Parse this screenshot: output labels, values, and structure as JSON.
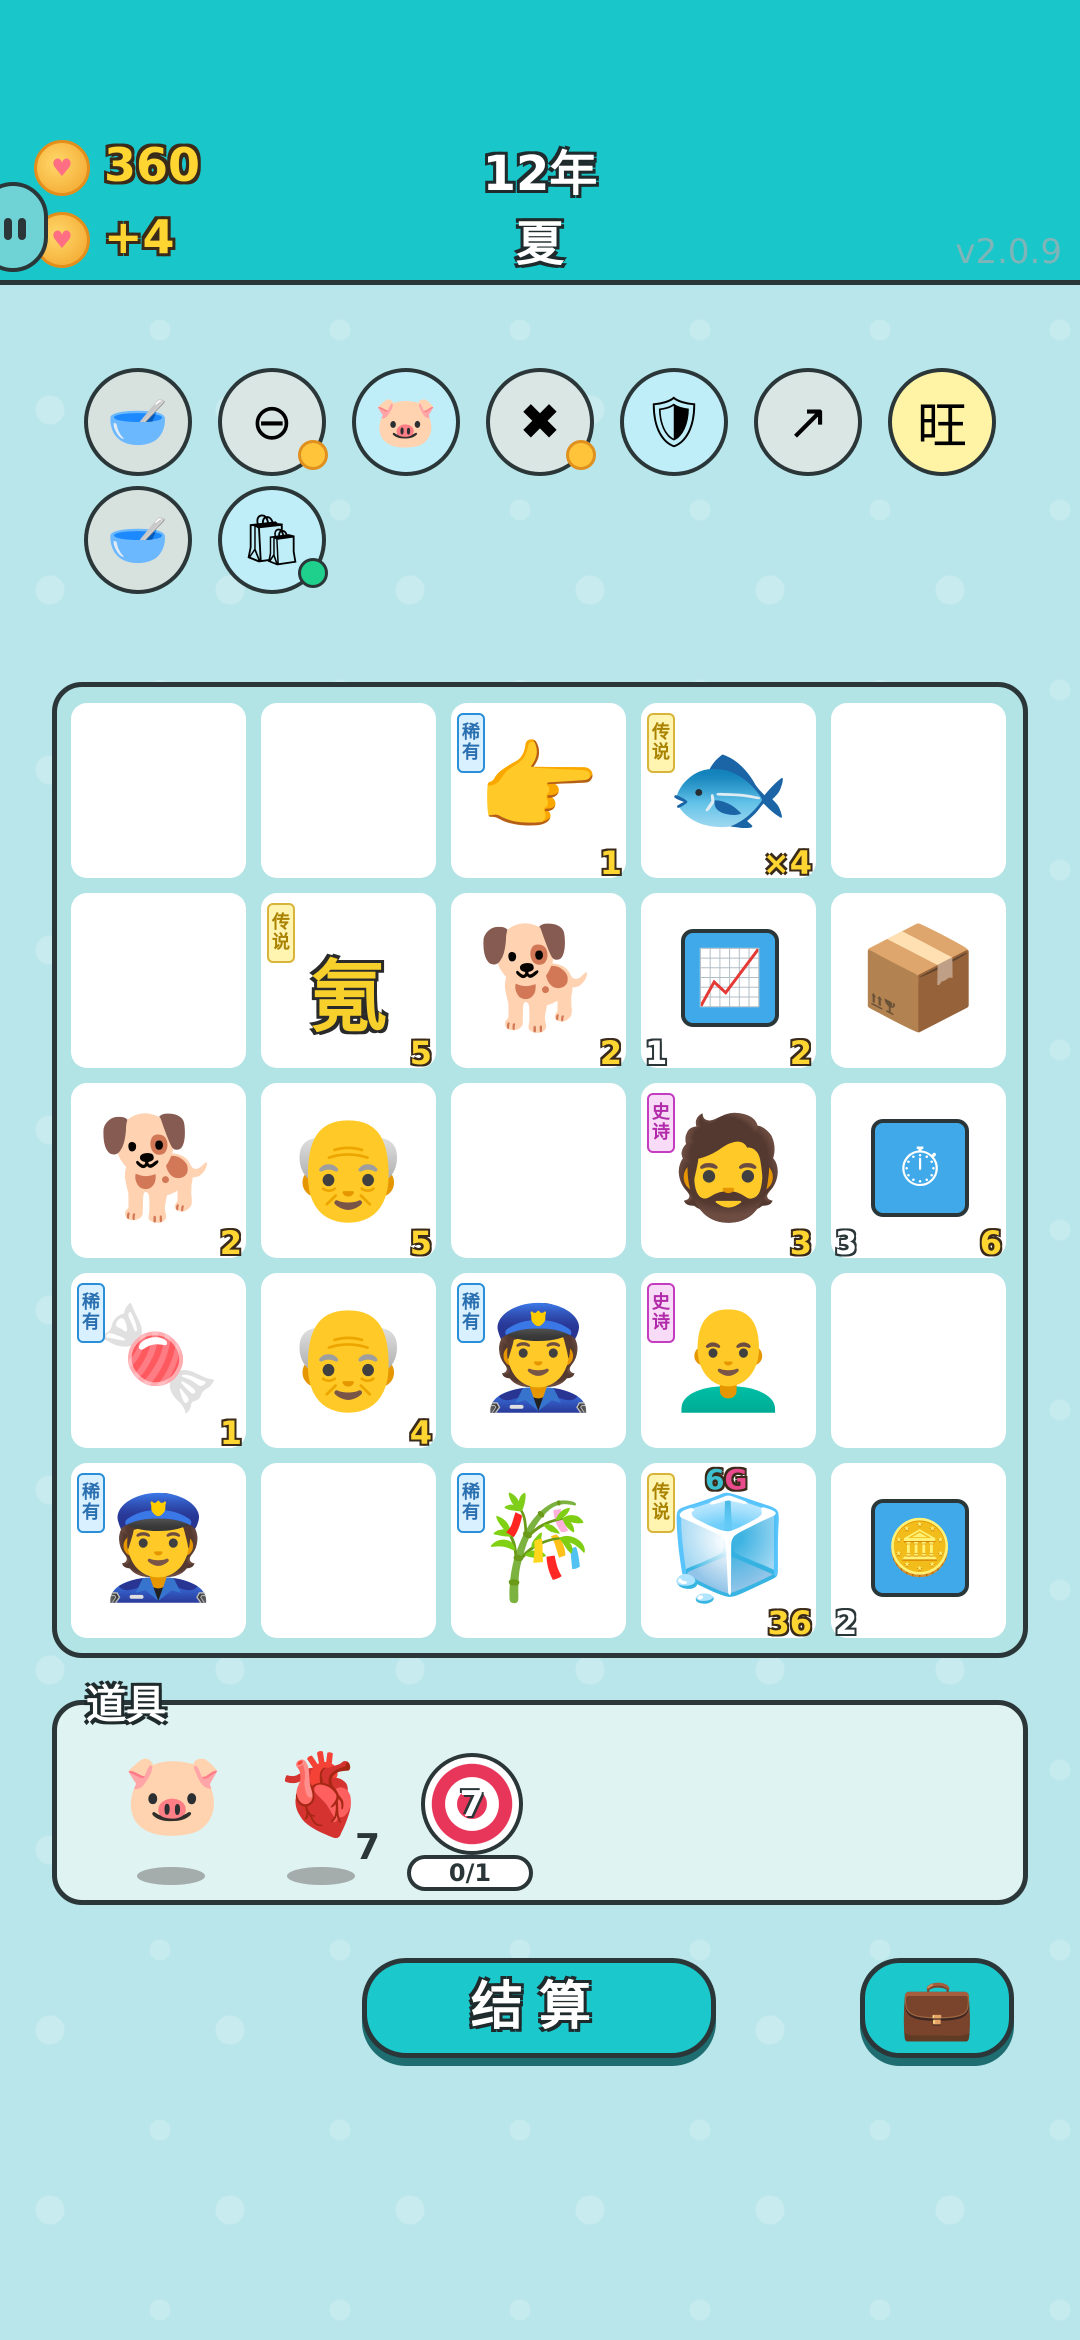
{
  "header": {
    "coins": "360",
    "income": "+4",
    "year": "12年",
    "season": "夏",
    "version": "v2.0.9"
  },
  "relics": [
    {
      "icon": "dog-bowl-icon",
      "glyph": "🥣"
    },
    {
      "icon": "minus-circle-icon",
      "glyph": "⊖"
    },
    {
      "icon": "piggy-bank-icon",
      "glyph": "🐷"
    },
    {
      "icon": "delete-tag-icon",
      "glyph": "✖"
    },
    {
      "icon": "shield-wrench-icon",
      "glyph": "🛡"
    },
    {
      "icon": "upgrade-arrow-icon",
      "glyph": "↗"
    },
    {
      "icon": "wang-character-icon",
      "glyph": "旺"
    },
    {
      "icon": "dog-bowl-icon",
      "glyph": "🥣"
    },
    {
      "icon": "rice-sack-icon",
      "glyph": "🛍"
    }
  ],
  "rarity_labels": {
    "rare": "稀有",
    "legendary": "传说",
    "epic": "史诗"
  },
  "board": [
    [
      {
        "empty": true
      },
      {
        "empty": true
      },
      {
        "icon": "pointing-hand-icon",
        "glyph": "👉",
        "rarity": "rare",
        "br": "1"
      },
      {
        "icon": "koi-fish-icon",
        "glyph": "🐟",
        "rarity": "legendary",
        "br": "×4"
      },
      {
        "empty": true
      }
    ],
    [
      {
        "empty": true
      },
      {
        "icon": "krypton-character-icon",
        "text": "氪",
        "rarity": "legendary",
        "br": "5"
      },
      {
        "icon": "husky-dog-icon",
        "glyph": "🐕",
        "br": "2"
      },
      {
        "icon": "trend-chart-icon",
        "glyph": "📈",
        "bl": "1",
        "br": "2"
      },
      {
        "icon": "cardboard-box-icon",
        "glyph": "📦"
      }
    ],
    [
      {
        "icon": "husky-dog-icon",
        "glyph": "🐕",
        "br": "2"
      },
      {
        "icon": "old-man-glasses-icon",
        "glyph": "👴",
        "br": "5"
      },
      {
        "empty": true
      },
      {
        "icon": "bearded-old-man-icon",
        "glyph": "🧔",
        "rarity": "epic",
        "br": "3"
      },
      {
        "icon": "stopwatch-gem-icon",
        "glyph": "⏱",
        "bl": "3",
        "br": "6"
      }
    ],
    [
      {
        "icon": "gumball-bowl-icon",
        "glyph": "🍬",
        "rarity": "rare",
        "br": "1"
      },
      {
        "icon": "old-man-glasses-icon",
        "glyph": "👴",
        "br": "4"
      },
      {
        "icon": "police-officer-icon",
        "glyph": "👮",
        "rarity": "rare"
      },
      {
        "icon": "bald-old-man-icon",
        "glyph": "👨‍🦲",
        "rarity": "epic"
      },
      {
        "empty": true
      }
    ],
    [
      {
        "icon": "police-officer-icon",
        "glyph": "👮",
        "rarity": "rare"
      },
      {
        "empty": true
      },
      {
        "icon": "bamboo-icon",
        "glyph": "🎋",
        "rarity": "rare"
      },
      {
        "icon": "refrigerator-icon",
        "glyph": "🧊",
        "rarity": "legendary",
        "top_a": "6",
        "top_b": "G",
        "br": "36"
      },
      {
        "icon": "gold-bars-icon",
        "glyph": "🪙",
        "bl": "2"
      }
    ]
  ],
  "tools": {
    "label": "道具",
    "items": [
      {
        "icon": "piggy-bank-icon",
        "glyph": "🐷"
      },
      {
        "icon": "liver-icon",
        "glyph": "🫀",
        "count": "7"
      },
      {
        "icon": "target-icon",
        "value": "7",
        "progress": "0/1"
      }
    ]
  },
  "actions": {
    "settle": "结算",
    "bag_icon": "briefcase-icon",
    "bag_glyph": "💼"
  }
}
